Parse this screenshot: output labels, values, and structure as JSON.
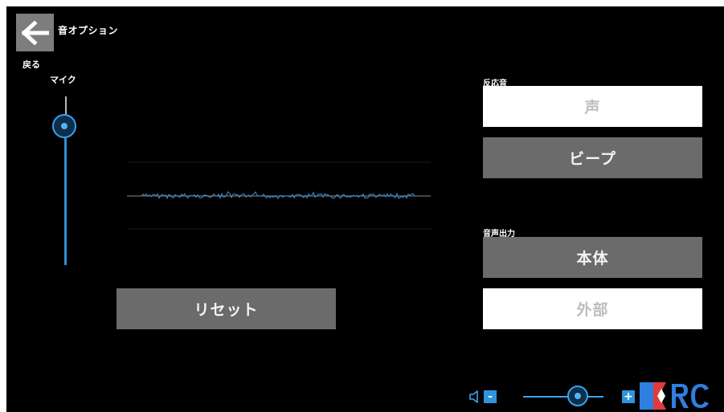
{
  "header": {
    "title": "音オプション",
    "back_label": "戻る"
  },
  "mic": {
    "label": "マイク",
    "level": 0.9
  },
  "reaction": {
    "label": "反応音",
    "options": [
      "声",
      "ビープ"
    ],
    "selected": "ビープ"
  },
  "output": {
    "label": "音声出力",
    "options": [
      "本体",
      "外部"
    ],
    "selected": "本体"
  },
  "reset_label": "リセット",
  "volume": {
    "minus": "-",
    "plus": "+",
    "level": 0.6
  },
  "colors": {
    "accent": "#2f94dd",
    "selected_button": "#6b6b6b",
    "unselected_button": "#ffffff"
  },
  "icons": [
    "back-arrow-icon",
    "speaker-icon",
    "rc-logo"
  ]
}
